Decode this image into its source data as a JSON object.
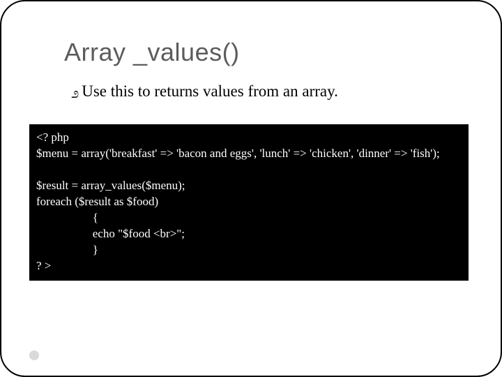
{
  "title": "Array _values()",
  "bullet": "Use this to returns values from an array.",
  "code": "<? php\n$menu = array('breakfast' => 'bacon and eggs', 'lunch' => 'chicken', 'dinner' => 'fish');\n\n$result = array_values($menu);\nforeach ($result as $food)\n                   {\n                   echo \"$food <br>\";\n                   }\n? >"
}
